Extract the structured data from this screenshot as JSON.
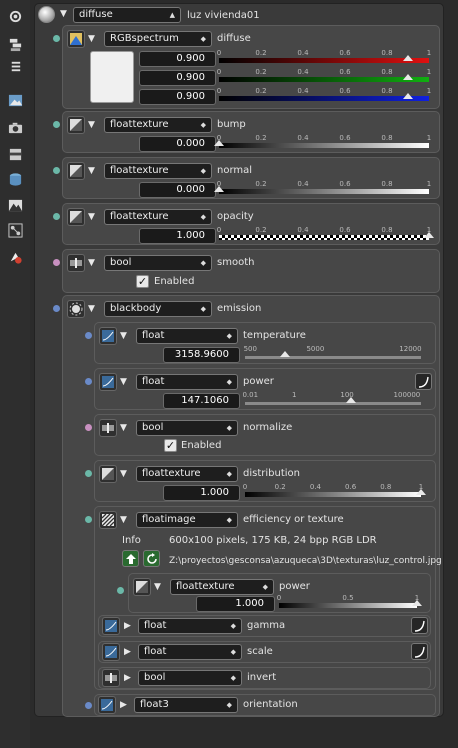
{
  "header": {
    "channel": "diffuse",
    "material": "luz vivienda01"
  },
  "colors": {
    "red": "#e01010",
    "green": "#10b010",
    "blue": "#1020e0",
    "socket_teal": "#6bb8a8",
    "socket_blue": "#6a8ac8",
    "socket_pink": "#c890c0"
  },
  "diffuse": {
    "type": "RGBspectrum",
    "label": "diffuse",
    "values": [
      "0.900",
      "0.900",
      "0.900"
    ],
    "ticks": [
      "0",
      "0.2",
      "0.4",
      "0.6",
      "0.8",
      "1"
    ]
  },
  "bump": {
    "type": "floattexture",
    "label": "bump",
    "value": "0.000",
    "ticks": [
      "0",
      "0.2",
      "0.4",
      "0.6",
      "0.8",
      "1"
    ]
  },
  "normal": {
    "type": "floattexture",
    "label": "normal",
    "value": "0.000",
    "ticks": [
      "0",
      "0.2",
      "0.4",
      "0.6",
      "0.8",
      "1"
    ]
  },
  "opacity": {
    "type": "floattexture",
    "label": "opacity",
    "value": "1.000",
    "ticks": [
      "0",
      "0.2",
      "0.4",
      "0.6",
      "0.8",
      "1"
    ]
  },
  "smooth": {
    "type": "bool",
    "label": "smooth",
    "checkbox": "Enabled"
  },
  "emission": {
    "type": "blackbody",
    "label": "emission",
    "temperature": {
      "type": "float",
      "label": "temperature",
      "value": "3158.9600",
      "ticks": [
        "500",
        "5000",
        "12000"
      ]
    },
    "power": {
      "type": "float",
      "label": "power",
      "value": "147.1060",
      "ticks": [
        "0.01",
        "1",
        "100",
        "100000"
      ]
    },
    "normalize": {
      "type": "bool",
      "label": "normalize",
      "checkbox": "Enabled"
    },
    "distribution": {
      "type": "floattexture",
      "label": "distribution",
      "value": "1.000",
      "ticks": [
        "0",
        "0.2",
        "0.4",
        "0.6",
        "0.8",
        "1"
      ]
    },
    "efficiency": {
      "type": "floatimage",
      "label": "efficiency or texture",
      "info_label": "Info",
      "info_text": "600x100 pixels, 175 KB, 24 bpp RGB LDR",
      "path": "Z:\\proyectos\\gesconsa\\azuqueca\\3D\\texturas\\luz_control.jpg",
      "power": {
        "type": "floattexture",
        "label": "power",
        "value": "1.000",
        "ticks": [
          "0",
          "0.5",
          "1"
        ]
      },
      "gamma": {
        "type": "float",
        "label": "gamma"
      },
      "scale": {
        "type": "float",
        "label": "scale"
      },
      "invert": {
        "type": "bool",
        "label": "invert"
      }
    },
    "orientation": {
      "type": "float3",
      "label": "orientation"
    }
  }
}
